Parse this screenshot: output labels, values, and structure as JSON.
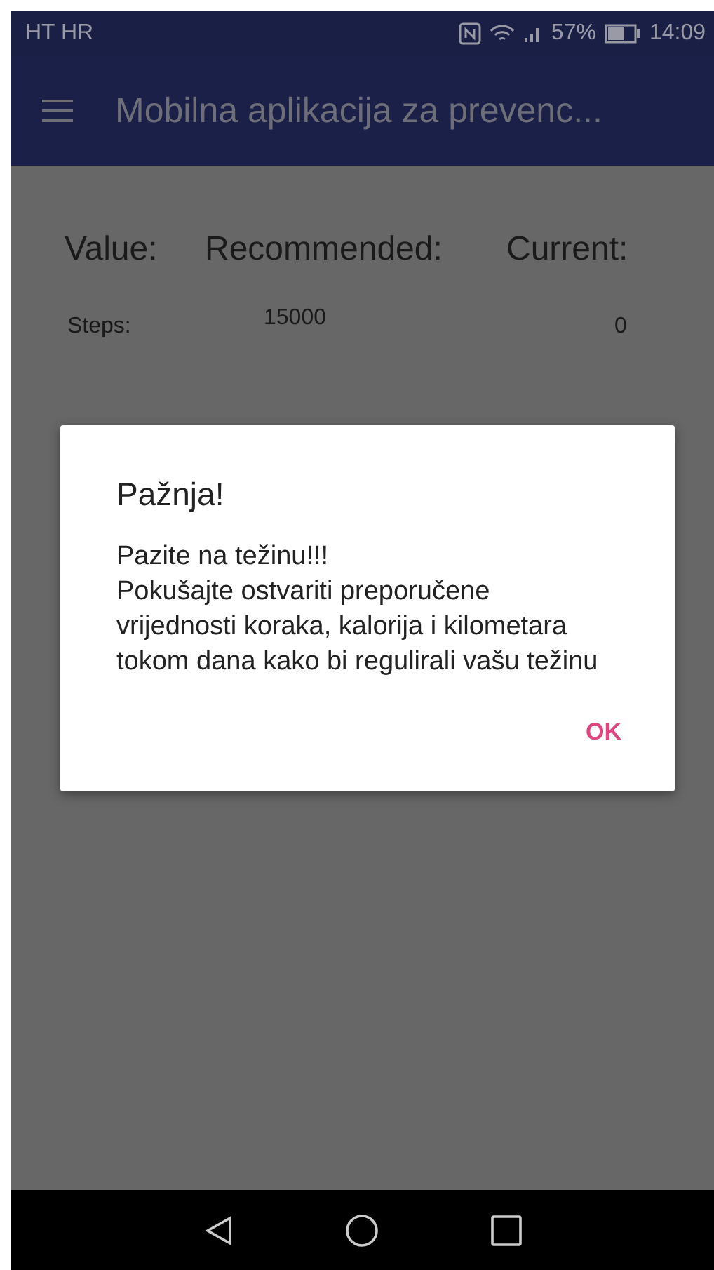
{
  "status_bar": {
    "carrier": "HT HR",
    "battery": "57%",
    "time": "14:09"
  },
  "app_bar": {
    "title": "Mobilna aplikacija za prevenc..."
  },
  "table": {
    "columns": [
      "Value:",
      "Recommended:",
      "Current:"
    ],
    "rows": [
      {
        "label": "Steps:",
        "recommended": "15000",
        "current": "0"
      }
    ]
  },
  "dialog": {
    "title": "Pažnja!",
    "message": "Pazite na težinu!!!\nPokušajte ostvariti preporučene vrijednosti koraka, kalorija i kilometara tokom dana kako bi regulirali vašu težinu",
    "buttons": [
      "OK"
    ]
  }
}
